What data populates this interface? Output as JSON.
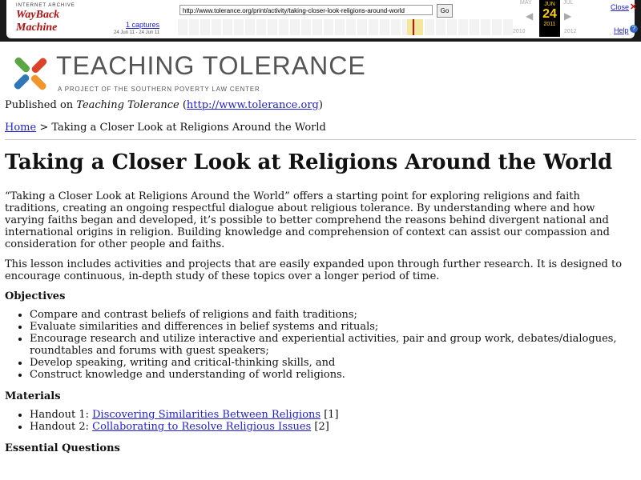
{
  "wayback": {
    "logo_top": "INTERNET ARCHIVE",
    "logo_main": "WayBack Machine",
    "url": "http://www.tolerance.org/print/activity/taking-closer-look-religions-around-world",
    "go": "Go",
    "captures": "1 captures",
    "range": "24 Jun 11 - 24 Jun 11",
    "prev_month": "MAY",
    "month": "JUN",
    "next_month": "JUL",
    "day": "24",
    "year": "2011",
    "prev_year": "2010",
    "next_year": "2012",
    "close": "Close",
    "help": "Help"
  },
  "site": {
    "brand": "TEACHING TOLERANCE",
    "tagline": "A PROJECT OF THE SOUTHERN POVERTY LAW CENTER",
    "published_prefix": "Published on ",
    "published_site": "Teaching Tolerance",
    "published_open": " (",
    "published_url": "http://www.tolerance.org",
    "published_close": ")",
    "breadcrumb_home": "Home",
    "breadcrumb_rest": " > Taking a Closer Look at Religions Around the World"
  },
  "page": {
    "title": "Taking a Closer Look at Religions Around the World",
    "intro": "“Taking a Closer Look at Religions Around the World” offers a starting point for exploring religions and faith traditions, creating an ongoing respectful dialogue about religious tolerance. By understanding where and how varying faiths began and developed, it’s possible to better comprehend the reasons behind divergent national and international origins in religion. Building knowledge and comprehension of context can assist our compassion and consideration for other people and faiths.",
    "lesson": "This lesson includes activities and projects that are easily expanded upon through further research. It is designed to encourage continuous, in-depth study of these topics over a longer period of time.",
    "objectives_heading": "Objectives",
    "objectives": [
      "Compare and contrast beliefs of religions and faith traditions;",
      "Evaluate similarities and differences in belief systems and rituals;",
      "Encourage research and utilize interactive and experiential activities, pair and group work, debates/dialogues, roundtables and forums with guest speakers;",
      "Develop speaking, writing and critical-thinking skills, and",
      "Construct knowledge and understanding of world religions."
    ],
    "materials_heading": "Materials",
    "materials": [
      {
        "prefix": "Handout 1: ",
        "link": "Discovering Similarities Between Religions",
        "suffix": " [1]"
      },
      {
        "prefix": "Handout 2: ",
        "link": "Collaborating to Resolve Religious Issues",
        "suffix": " [2]"
      }
    ],
    "eq_heading": "Essential Questions"
  },
  "colors": {
    "link": "#2222cc",
    "logo_red": "#d8432a",
    "logo_orange": "#f0962b",
    "logo_green": "#5aa544",
    "logo_blue": "#2f77b7"
  }
}
